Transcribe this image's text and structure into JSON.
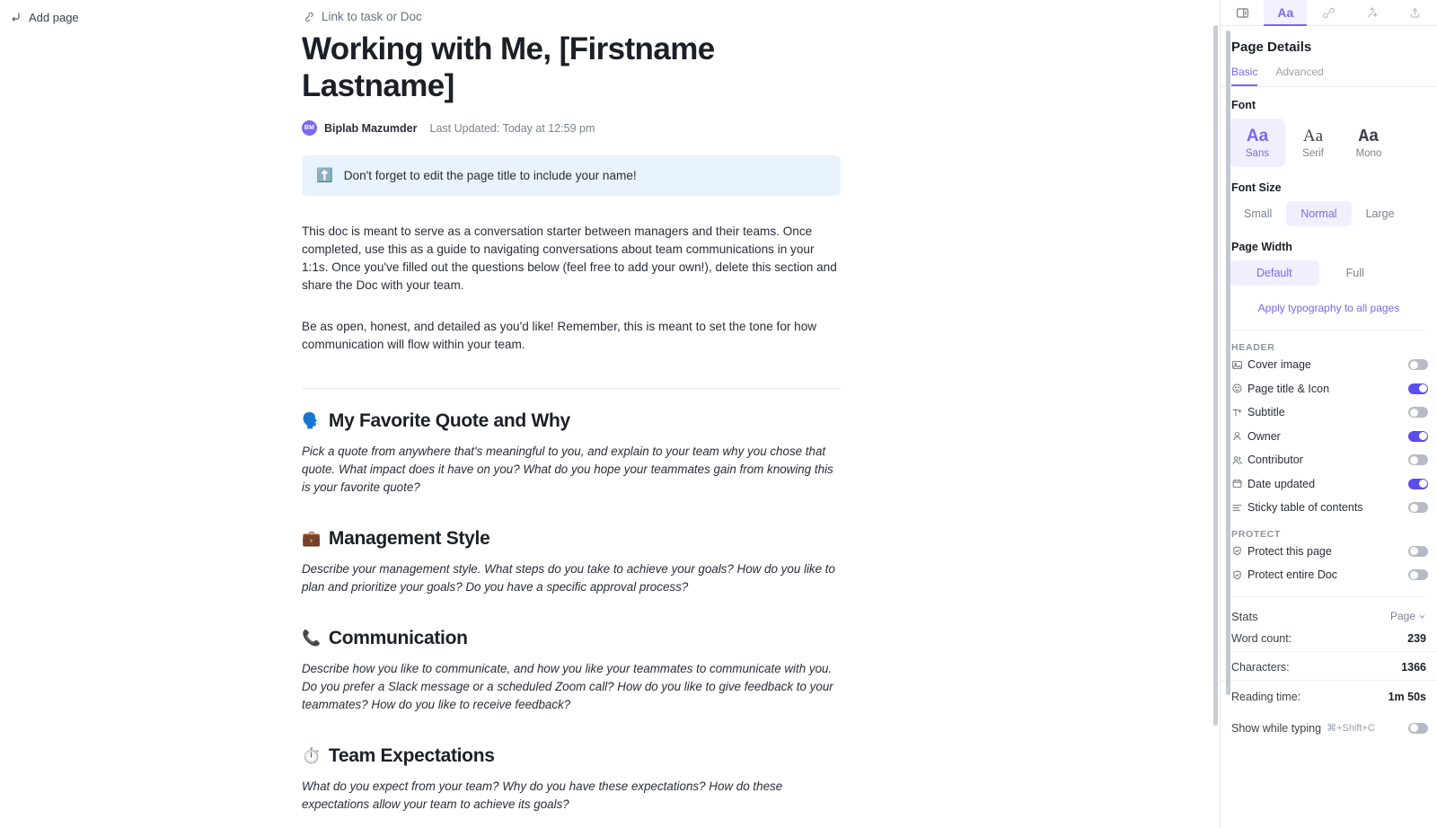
{
  "topbar": {
    "add_page": "Add page",
    "link_task": "Link to task or Doc"
  },
  "document": {
    "title": "Working with Me, [Firstname Lastname]",
    "avatar_initials": "BM",
    "author": "Biplab Mazumder",
    "last_updated": "Last Updated: Today at 12:59 pm",
    "callout": {
      "emoji": "⬆️",
      "text": "Don't forget to edit the page title to include your name!"
    },
    "paragraph_1": "This doc is meant to serve as a conversation starter between managers and their teams. Once completed, use this as a guide to navigating conversations about team communications in your 1:1s. Once you've filled out the questions below (feel free to add your own!), delete this section and share the Doc with your team.",
    "paragraph_2": "Be as open, honest, and detailed as you'd like! Remember, this is meant to set the tone for how communication will flow within your team.",
    "sections": [
      {
        "emoji": "🗣️",
        "heading": "My Favorite Quote and Why",
        "prompt": "Pick a quote from anywhere that's meaningful to you, and explain to your team why you chose that quote. What impact does it have on you? What do you hope your teammates gain from knowing this is your favorite quote?"
      },
      {
        "emoji": "💼",
        "heading": "Management Style",
        "prompt": "Describe your management style. What steps do you take to achieve your goals? How do you like to plan and prioritize your goals? Do you have a specific approval process?"
      },
      {
        "emoji": "📞",
        "heading": "Communication",
        "prompt": "Describe how you like to communicate, and how you like your teammates to communicate with you. Do you prefer a Slack message or a scheduled Zoom call? How do you like to give feedback to your teammates? How do you like to receive feedback?"
      },
      {
        "emoji": "⏱️",
        "heading": "Team Expectations",
        "prompt": "What do you expect from your team? Why do you have these expectations? How do these expectations allow your team to achieve its goals?"
      }
    ]
  },
  "panel": {
    "tabs": [
      {
        "name": "sidebar-toggle",
        "label": ""
      },
      {
        "name": "typography",
        "label": "Aa",
        "active": true
      },
      {
        "name": "edit-pen",
        "label": ""
      },
      {
        "name": "magic-wand",
        "label": ""
      },
      {
        "name": "share-upload",
        "label": ""
      }
    ],
    "title": "Page Details",
    "sub_tabs": [
      {
        "label": "Basic",
        "active": true
      },
      {
        "label": "Advanced",
        "active": false
      }
    ],
    "font": {
      "label": "Font",
      "options": [
        {
          "sample": "Aa",
          "name": "Sans",
          "active": true
        },
        {
          "sample": "Aa",
          "name": "Serif",
          "active": false
        },
        {
          "sample": "Aa",
          "name": "Mono",
          "active": false
        }
      ]
    },
    "font_size": {
      "label": "Font Size",
      "options": [
        {
          "label": "Small",
          "active": false
        },
        {
          "label": "Normal",
          "active": true
        },
        {
          "label": "Large",
          "active": false
        }
      ]
    },
    "page_width": {
      "label": "Page Width",
      "options": [
        {
          "label": "Default",
          "active": true
        },
        {
          "label": "Full",
          "active": false
        }
      ]
    },
    "apply_link": "Apply typography to all pages",
    "header_section": {
      "caption": "HEADER",
      "items": [
        {
          "icon": "image-icon",
          "label": "Cover image",
          "on": false
        },
        {
          "icon": "smiley-icon",
          "label": "Page title & Icon",
          "on": true
        },
        {
          "icon": "subtitle-icon",
          "label": "Subtitle",
          "on": false
        },
        {
          "icon": "person-icon",
          "label": "Owner",
          "on": true
        },
        {
          "icon": "people-icon",
          "label": "Contributor",
          "on": false
        },
        {
          "icon": "calendar-icon",
          "label": "Date updated",
          "on": true
        },
        {
          "icon": "list-icon",
          "label": "Sticky table of contents",
          "on": false
        }
      ]
    },
    "protect_section": {
      "caption": "PROTECT",
      "items": [
        {
          "icon": "shield-check-icon",
          "label": "Protect this page",
          "on": false
        },
        {
          "icon": "shield-icon",
          "label": "Protect entire Doc",
          "on": false
        }
      ]
    },
    "stats": {
      "label": "Stats",
      "scope": "Page",
      "rows": [
        {
          "key": "Word count:",
          "value": "239"
        },
        {
          "key": "Characters:",
          "value": "1366"
        },
        {
          "key": "Reading time:",
          "value": "1m 50s"
        }
      ]
    },
    "show_while_typing": {
      "label": "Show while typing",
      "shortcut": "⌘+Shift+C",
      "on": false
    }
  },
  "colors": {
    "accent": "#7b68ee",
    "toggle_on": "#5b4dee",
    "callout_bg": "#e9f3fb"
  }
}
